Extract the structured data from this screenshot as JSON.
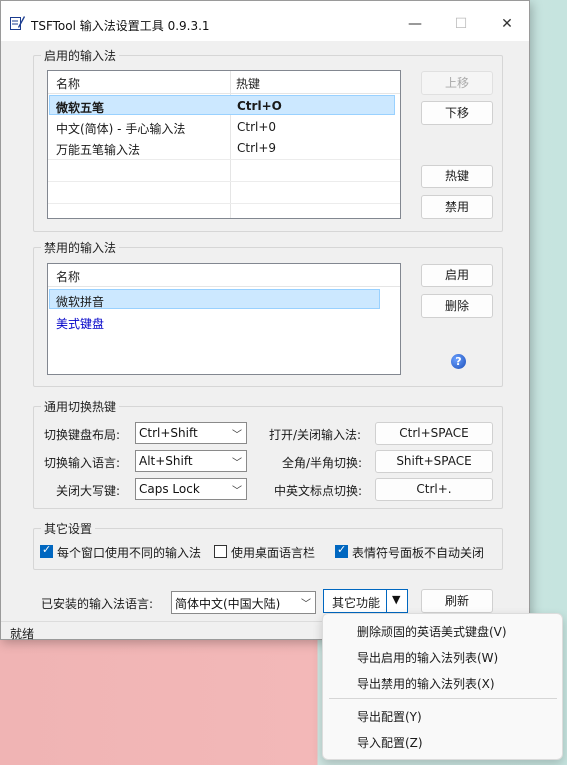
{
  "window": {
    "title": "TSFTool 输入法设置工具 0.9.3.1",
    "minimize": "—",
    "maximize": "☐",
    "close": "✕"
  },
  "enabled_group": {
    "title": "启用的输入法",
    "columns": [
      "名称",
      "热键"
    ],
    "rows": [
      {
        "name": "微软五笔",
        "hotkey": "Ctrl+O"
      },
      {
        "name": "中文(简体) - 手心输入法",
        "hotkey": "Ctrl+0"
      },
      {
        "name": "万能五笔输入法",
        "hotkey": "Ctrl+9"
      }
    ],
    "buttons": {
      "move_up": "上移",
      "move_down": "下移",
      "hotkey": "热键",
      "disable": "禁用"
    }
  },
  "disabled_group": {
    "title": "禁用的输入法",
    "columns": [
      "名称"
    ],
    "rows": [
      {
        "name": "微软拼音"
      },
      {
        "name": "美式键盘"
      }
    ],
    "buttons": {
      "enable": "启用",
      "delete": "删除"
    },
    "help_icon": "?"
  },
  "hotkeys_group": {
    "title": "通用切换热键",
    "switch_layout_label": "切换键盘布局:",
    "switch_layout_value": "Ctrl+Shift",
    "switch_language_label": "切换输入语言:",
    "switch_language_value": "Alt+Shift",
    "caps_off_label": "关闭大写键:",
    "caps_off_value": "Caps Lock",
    "toggle_ime_label": "打开/关闭输入法:",
    "toggle_ime_value": "Ctrl+SPACE",
    "fullhalf_label": "全角/半角切换:",
    "fullhalf_value": "Shift+SPACE",
    "punct_label": "中英文标点切换:",
    "punct_value": "Ctrl+."
  },
  "other_group": {
    "title": "其它设置",
    "opt1": {
      "label": "每个窗口使用不同的输入法",
      "checked": true
    },
    "opt2": {
      "label": "使用桌面语言栏",
      "checked": false
    },
    "opt3": {
      "label": "表情符号面板不自动关闭",
      "checked": true
    }
  },
  "bottom": {
    "installed_label": "已安装的输入法语言:",
    "language_value": "简体中文(中国大陆)",
    "other_functions": "其它功能",
    "refresh": "刷新"
  },
  "status": "就绪",
  "menu": {
    "items": [
      "删除顽固的英语美式键盘(V)",
      "导出启用的输入法列表(W)",
      "导出禁用的输入法列表(X)",
      "导出配置(Y)",
      "导入配置(Z)"
    ]
  },
  "colors": {
    "selection": "#cce8ff",
    "accent": "#0067c0",
    "link_blue": "#0000c8"
  }
}
